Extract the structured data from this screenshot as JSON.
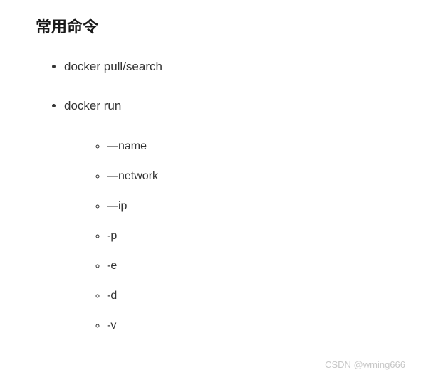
{
  "heading": "常用命令",
  "items": [
    {
      "label": "docker pull/search",
      "subitems": []
    },
    {
      "label": "docker run",
      "subitems": [
        "—name",
        "—network",
        "—ip",
        "-p",
        "-e",
        "-d",
        "-v"
      ]
    }
  ],
  "watermark": "CSDN @wming666"
}
